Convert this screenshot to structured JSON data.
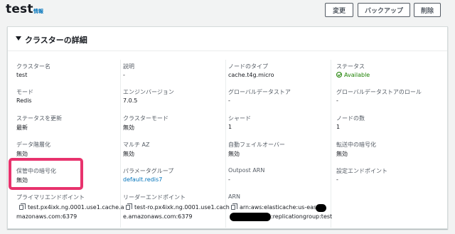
{
  "header": {
    "title": "test",
    "info_link": "情報",
    "buttons": {
      "edit": "変更",
      "backup": "バックアップ",
      "delete": "削除"
    }
  },
  "panel": {
    "title": "クラスターの詳細",
    "col1": [
      {
        "label": "クラスター名",
        "value": "test"
      },
      {
        "label": "モード",
        "value": "Redis"
      },
      {
        "label": "ステータスを更新",
        "value": "最新"
      },
      {
        "label": "データ階層化",
        "value": "無効"
      },
      {
        "label": "保管中の暗号化",
        "value": "無効"
      },
      {
        "label": "プライマリエンドポイント",
        "value_line1": "test.px4ixk.ng.0001.use1.cache.a",
        "value_line2": "mazonaws.com:6379"
      }
    ],
    "col2": [
      {
        "label": "説明",
        "value": "-"
      },
      {
        "label": "エンジンバージョン",
        "value": "7.0.5"
      },
      {
        "label": "クラスターモード",
        "value": "無効"
      },
      {
        "label": "マルチ AZ",
        "value": "無効"
      },
      {
        "label": "パラメータグループ",
        "value": "default.redis7"
      },
      {
        "label": "リーダーエンドポイント",
        "value_line1": "test-ro.px4ixk.ng.0001.use1.cach",
        "value_line2": "e.amazonaws.com:6379"
      }
    ],
    "col3": [
      {
        "label": "ノードのタイプ",
        "value": "cache.t4g.micro"
      },
      {
        "label": "グローバルデータストア",
        "value": "-"
      },
      {
        "label": "シャード",
        "value": "1"
      },
      {
        "label": "自動フェイルオーバー",
        "value": "無効"
      },
      {
        "label": "Outpost ARN",
        "value": "-"
      },
      {
        "label": "ARN",
        "value_line1": "arn:aws:elasticache:us-east-1",
        "value_line2": ":replicationgroup:test"
      }
    ],
    "col4": [
      {
        "label": "ステータス",
        "value": "Available"
      },
      {
        "label": "グローバルデータストアのロール",
        "value": "-"
      },
      {
        "label": "ノードの数",
        "value": "1"
      },
      {
        "label": "転送中の暗号化",
        "value": "無効"
      },
      {
        "label": "設定エンドポイント",
        "value": "-"
      }
    ]
  },
  "colors": {
    "link": "#0073bb",
    "success": "#1d8102",
    "highlight": "#e8336d"
  }
}
